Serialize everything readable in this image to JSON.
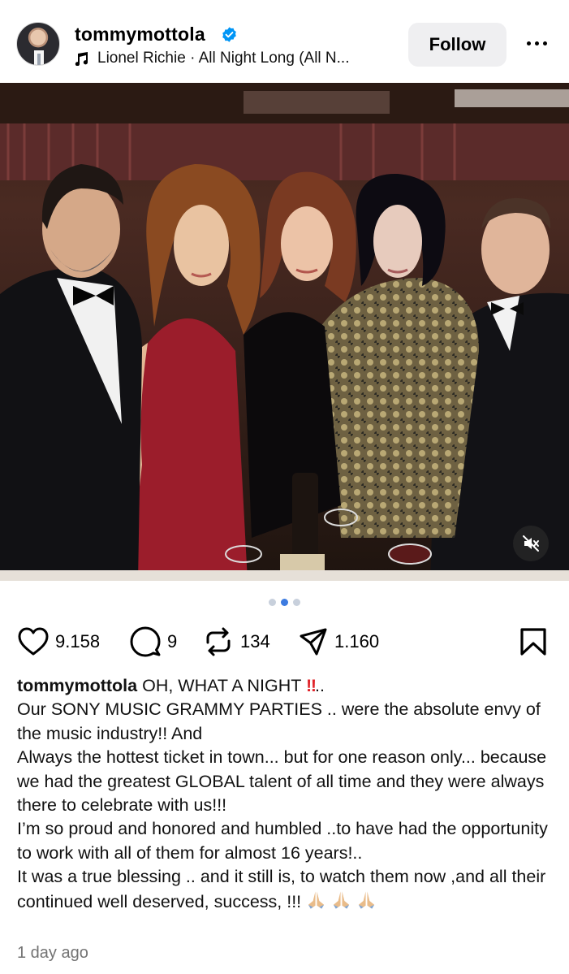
{
  "header": {
    "username": "tommymottola",
    "verified": true,
    "music": "Lionel Richie · All Night Long (All N...",
    "follow_label": "Follow"
  },
  "photo": {
    "description_icon": "mute-icon"
  },
  "carousel": {
    "count": 3,
    "active_index": 1
  },
  "actions": {
    "likes": "9.158",
    "comments": "9",
    "reposts": "134",
    "shares": "1.160"
  },
  "caption": {
    "username": "tommymottola",
    "title": "OH, WHAT A NIGHT",
    "title_suffix": "..",
    "emphasis": "‼",
    "line1": "Our SONY MUSIC GRAMMY PARTIES .. were the absolute envy of the music industry!! And",
    "line2": "Always the hottest ticket in town... but for one reason only... because we had the greatest GLOBAL talent of all time and they were always there to celebrate with us!!!",
    "line3": "I’m so proud and honored and humbled ..to have had the opportunity to work with all of them for almost 16 years!..",
    "line4": "It was a true blessing .. and it still is, to watch them now ,and all their continued well deserved, success, !!!"
  },
  "timestamp": "1 day ago",
  "colors": {
    "accent": "#3d7be0",
    "verified": "#0095f6",
    "emphasis": "#e0242a",
    "muted_text": "#737373"
  }
}
